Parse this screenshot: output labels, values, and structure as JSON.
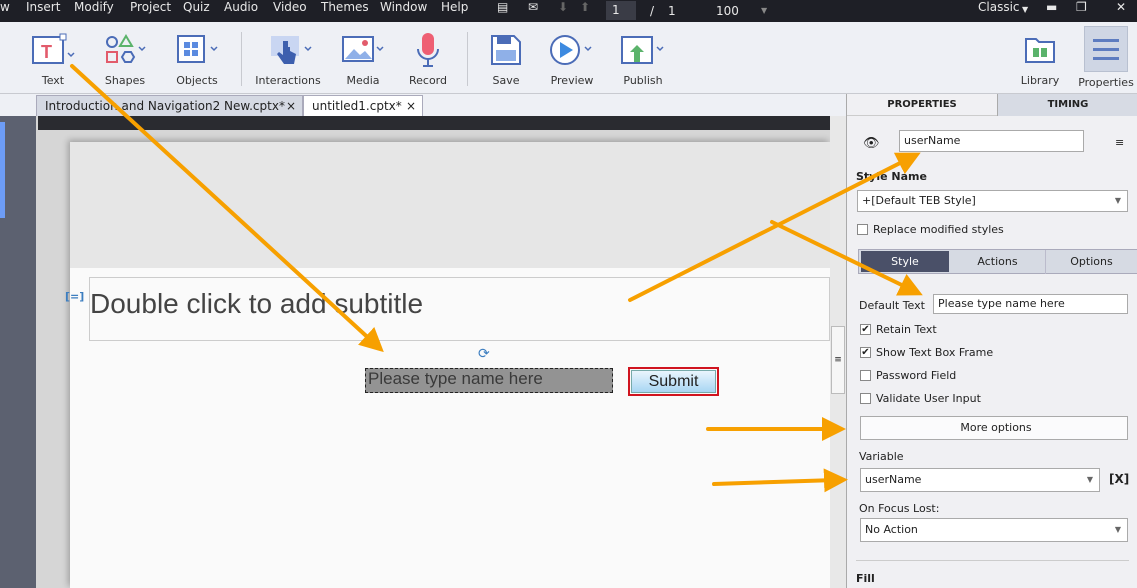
{
  "menu": {
    "items": [
      "w",
      "Insert",
      "Modify",
      "Project",
      "Quiz",
      "Audio",
      "Video",
      "Themes",
      "Window",
      "Help"
    ],
    "page_current": "1",
    "page_sep": "/",
    "page_total": "1",
    "zoom": "100",
    "workspace": "Classic"
  },
  "toolbar": {
    "text": "Text",
    "shapes": "Shapes",
    "objects": "Objects",
    "interactions": "Interactions",
    "media": "Media",
    "record": "Record",
    "save": "Save",
    "preview": "Preview",
    "publish": "Publish",
    "library": "Library",
    "properties": "Properties"
  },
  "tabs": [
    {
      "label": "Introduction and Navigation2 New.cptx*",
      "close": "×"
    },
    {
      "label": "untitled1.cptx*",
      "close": "×"
    }
  ],
  "slide": {
    "subtitle_placeholder": "Double click to add subtitle",
    "text_entry": "Please type name here",
    "submit": "Submit"
  },
  "panel": {
    "tab_properties": "PROPERTIES",
    "tab_timing": "TIMING",
    "name": "userName",
    "style_name_label": "Style Name",
    "style_name": "+[Default TEB Style]",
    "replace_modified": "Replace modified styles",
    "seg_style": "Style",
    "seg_actions": "Actions",
    "seg_options": "Options",
    "default_text_label": "Default Text",
    "default_text": "Please type name here",
    "retain_text": "Retain Text",
    "show_frame": "Show Text Box Frame",
    "password": "Password Field",
    "validate": "Validate User Input",
    "more_options": "More options",
    "variable_label": "Variable",
    "variable": "userName",
    "variable_btn": "[X]",
    "focus_lost_label": "On Focus Lost:",
    "focus_lost": "No Action",
    "fill_label": "Fill"
  },
  "checks": {
    "replace_modified": false,
    "retain_text": true,
    "show_frame": true,
    "password": false,
    "validate": false
  },
  "colors": {
    "accent_arrow": "#f7a000",
    "selected_segment": "#4a5068"
  }
}
